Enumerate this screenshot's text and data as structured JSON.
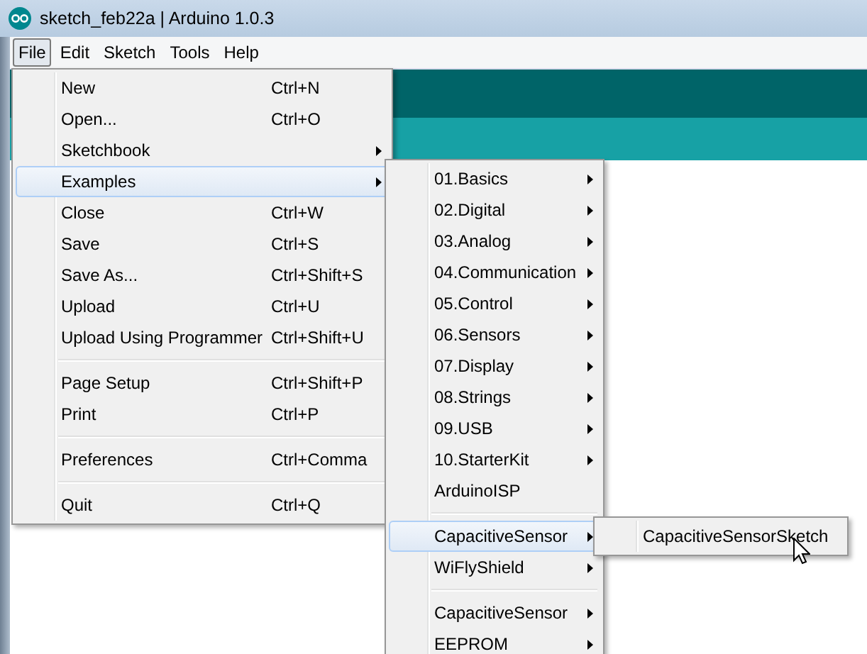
{
  "window": {
    "title": "sketch_feb22a | Arduino 1.0.3"
  },
  "menubar": [
    {
      "label": "File",
      "selected": true
    },
    {
      "label": "Edit",
      "selected": false
    },
    {
      "label": "Sketch",
      "selected": false
    },
    {
      "label": "Tools",
      "selected": false
    },
    {
      "label": "Help",
      "selected": false
    }
  ],
  "file_menu": [
    {
      "kind": "item",
      "label": "New",
      "shortcut": "Ctrl+N",
      "submenu": false,
      "selected": false
    },
    {
      "kind": "item",
      "label": "Open...",
      "shortcut": "Ctrl+O",
      "submenu": false,
      "selected": false
    },
    {
      "kind": "item",
      "label": "Sketchbook",
      "submenu": true,
      "selected": false
    },
    {
      "kind": "item",
      "label": "Examples",
      "submenu": true,
      "selected": true
    },
    {
      "kind": "item",
      "label": "Close",
      "shortcut": "Ctrl+W",
      "submenu": false,
      "selected": false
    },
    {
      "kind": "item",
      "label": "Save",
      "shortcut": "Ctrl+S",
      "submenu": false,
      "selected": false
    },
    {
      "kind": "item",
      "label": "Save As...",
      "shortcut": "Ctrl+Shift+S",
      "submenu": false,
      "selected": false
    },
    {
      "kind": "item",
      "label": "Upload",
      "shortcut": "Ctrl+U",
      "submenu": false,
      "selected": false
    },
    {
      "kind": "item",
      "label": "Upload Using Programmer",
      "shortcut": "Ctrl+Shift+U",
      "submenu": false,
      "selected": false
    },
    {
      "kind": "separator"
    },
    {
      "kind": "item",
      "label": "Page Setup",
      "shortcut": "Ctrl+Shift+P",
      "submenu": false,
      "selected": false
    },
    {
      "kind": "item",
      "label": "Print",
      "shortcut": "Ctrl+P",
      "submenu": false,
      "selected": false
    },
    {
      "kind": "separator"
    },
    {
      "kind": "item",
      "label": "Preferences",
      "shortcut": "Ctrl+Comma",
      "submenu": false,
      "selected": false
    },
    {
      "kind": "separator"
    },
    {
      "kind": "item",
      "label": "Quit",
      "shortcut": "Ctrl+Q",
      "submenu": false,
      "selected": false
    }
  ],
  "examples_menu": [
    {
      "kind": "item",
      "label": "01.Basics",
      "submenu": true,
      "selected": false
    },
    {
      "kind": "item",
      "label": "02.Digital",
      "submenu": true,
      "selected": false
    },
    {
      "kind": "item",
      "label": "03.Analog",
      "submenu": true,
      "selected": false
    },
    {
      "kind": "item",
      "label": "04.Communication",
      "submenu": true,
      "selected": false
    },
    {
      "kind": "item",
      "label": "05.Control",
      "submenu": true,
      "selected": false
    },
    {
      "kind": "item",
      "label": "06.Sensors",
      "submenu": true,
      "selected": false
    },
    {
      "kind": "item",
      "label": "07.Display",
      "submenu": true,
      "selected": false
    },
    {
      "kind": "item",
      "label": "08.Strings",
      "submenu": true,
      "selected": false
    },
    {
      "kind": "item",
      "label": "09.USB",
      "submenu": true,
      "selected": false
    },
    {
      "kind": "item",
      "label": "10.StarterKit",
      "submenu": true,
      "selected": false
    },
    {
      "kind": "item",
      "label": "ArduinoISP",
      "submenu": false,
      "selected": false
    },
    {
      "kind": "separator"
    },
    {
      "kind": "item",
      "label": "CapacitiveSensor",
      "submenu": true,
      "selected": true
    },
    {
      "kind": "item",
      "label": "WiFlyShield",
      "submenu": true,
      "selected": false
    },
    {
      "kind": "separator"
    },
    {
      "kind": "item",
      "label": "CapacitiveSensor",
      "submenu": true,
      "selected": false
    },
    {
      "kind": "item",
      "label": "EEPROM",
      "submenu": true,
      "selected": false
    }
  ],
  "capacitive_menu": [
    {
      "kind": "item",
      "label": "CapacitiveSensorSketch",
      "submenu": false,
      "selected": false
    }
  ]
}
